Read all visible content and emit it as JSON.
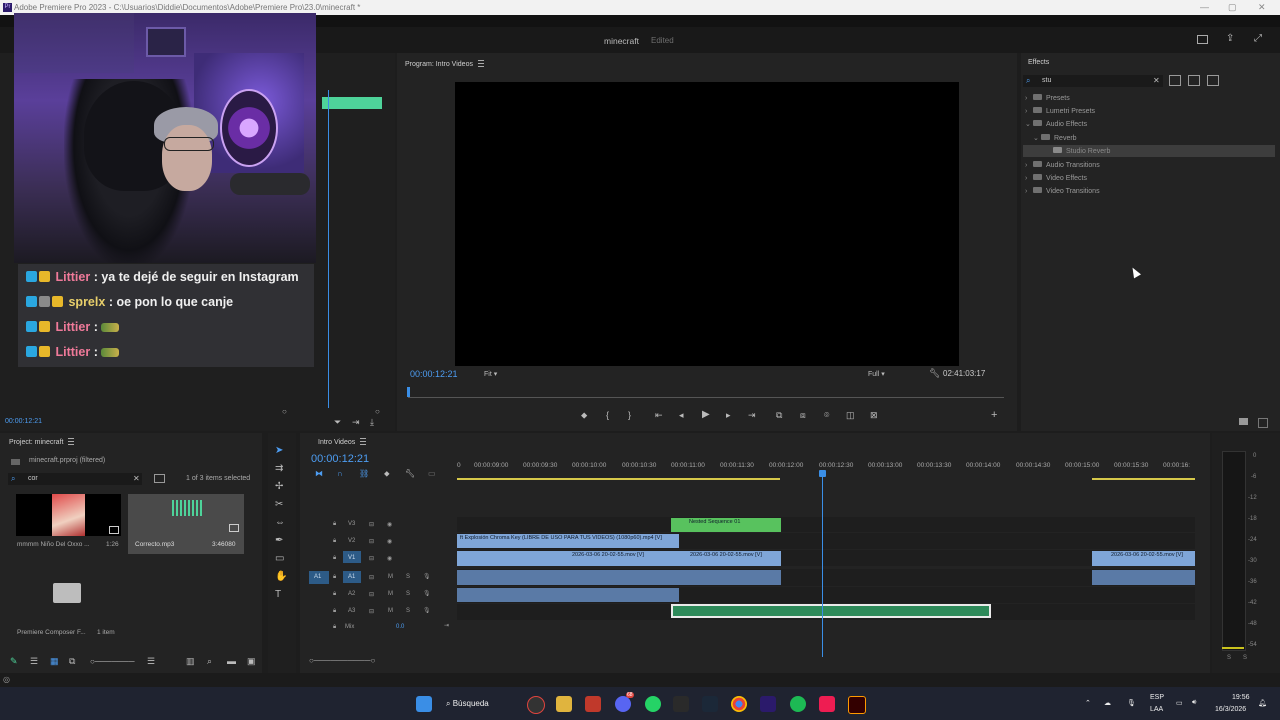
{
  "window": {
    "title": "Adobe Premiere Pro 2023 - C:\\Usuarios\\Diddie\\Documentos\\Adobe\\Premiere Pro\\23.0\\minecraft *",
    "app_icon": "Pr",
    "doc_title": "minecraft",
    "doc_status": "Edited"
  },
  "chat": {
    "messages": [
      {
        "user": "Littier",
        "text": ": ya te dejé de seguir en Instagram",
        "user_color": "#f07a9a"
      },
      {
        "user": "sprelx",
        "text": ": oe pon lo que canje",
        "user_color": "#e8cf6b"
      },
      {
        "user": "Littier",
        "text": ":",
        "user_color": "#f07a9a"
      },
      {
        "user": "Littier",
        "text": ":",
        "user_color": "#f07a9a"
      }
    ]
  },
  "source": {
    "timecode": "00:00:12:21"
  },
  "program": {
    "title": "Program: Intro Videos",
    "timecode": "00:00:12:21",
    "fit": "Fit",
    "quality": "Full",
    "duration": "02:41:03:17"
  },
  "effects": {
    "title": "Effects",
    "search": "stu",
    "tree": [
      {
        "label": "Presets"
      },
      {
        "label": "Lumetri Presets"
      },
      {
        "label": "Audio Effects"
      },
      {
        "label": "Reverb"
      },
      {
        "label": "Studio Reverb"
      },
      {
        "label": "Audio Transitions"
      },
      {
        "label": "Video Effects"
      },
      {
        "label": "Video Transitions"
      }
    ]
  },
  "project": {
    "title": "Project: minecraft",
    "file": "minecraft.prproj (filtered)",
    "search": "cor",
    "count": "1 of 3 items selected",
    "items": [
      {
        "name": "mmmm Niño Del Oxxo ...",
        "duration": "1:26"
      },
      {
        "name": "Correcto.mp3",
        "duration": "3:46080"
      },
      {
        "name": "Premiere Composer F...",
        "duration": "1 item"
      }
    ]
  },
  "timeline": {
    "title": "Intro Videos",
    "timecode": "00:00:12:21",
    "ruler": [
      "00:00:09:00",
      "00:00:09:30",
      "00:00:10:00",
      "00:00:10:30",
      "00:00:11:00",
      "00:00:11:30",
      "00:00:12:00",
      "00:00:12:30",
      "00:00:13:00",
      "00:00:13:30",
      "00:00:14:00",
      "00:00:14:30",
      "00:00:15:00",
      "00:00:15:30",
      "00:00:16:"
    ],
    "ruler_first": "0",
    "tracks": {
      "v3": "V3",
      "v2": "V2",
      "v1": "V1",
      "a1": "A1",
      "a2": "A2",
      "a3": "A3",
      "src_v1": "V1",
      "src_a1": "A1",
      "mix": "Mix",
      "mix_val": "0.0"
    },
    "clips": {
      "nested": "Nested Sequence 01",
      "chroma": "ft Explosión Chroma Key (LIBRE DE USO PARA TUS VIDEOS) (1080p60).mp4 [V]",
      "v1a": "2026-03-06 20-02-55.mov [V]",
      "v1b": "2026-03-06 20-02-55.mov [V]",
      "v1c": "2026-03-06 20-02-55.mov [V]"
    },
    "track_letters": {
      "m": "M",
      "s": "S"
    }
  },
  "meters": {
    "labels": [
      "0",
      "-6",
      "-12",
      "-18",
      "-24",
      "-30",
      "-36",
      "-42",
      "-48",
      "-54"
    ],
    "solo": "S"
  },
  "taskbar": {
    "search": "Búsqueda",
    "lang": "ESP",
    "lang2": "LAA",
    "time": "19:56",
    "date": "16/3/2026",
    "discord_badge": "68"
  }
}
